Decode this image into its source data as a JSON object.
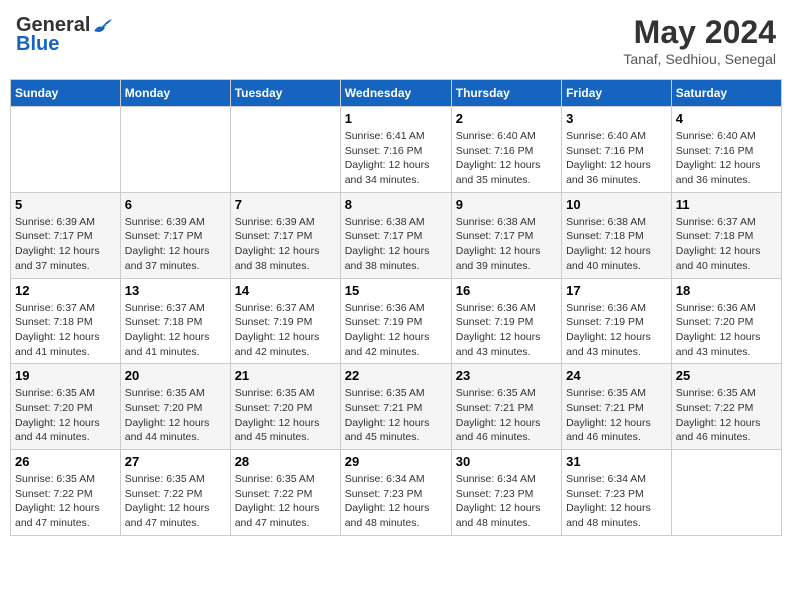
{
  "header": {
    "logo_general": "General",
    "logo_blue": "Blue",
    "title": "May 2024",
    "subtitle": "Tanaf, Sedhiou, Senegal"
  },
  "days_of_week": [
    "Sunday",
    "Monday",
    "Tuesday",
    "Wednesday",
    "Thursday",
    "Friday",
    "Saturday"
  ],
  "weeks": [
    {
      "days": [
        {
          "number": "",
          "info": ""
        },
        {
          "number": "",
          "info": ""
        },
        {
          "number": "",
          "info": ""
        },
        {
          "number": "1",
          "info": "Sunrise: 6:41 AM\nSunset: 7:16 PM\nDaylight: 12 hours\nand 34 minutes."
        },
        {
          "number": "2",
          "info": "Sunrise: 6:40 AM\nSunset: 7:16 PM\nDaylight: 12 hours\nand 35 minutes."
        },
        {
          "number": "3",
          "info": "Sunrise: 6:40 AM\nSunset: 7:16 PM\nDaylight: 12 hours\nand 36 minutes."
        },
        {
          "number": "4",
          "info": "Sunrise: 6:40 AM\nSunset: 7:16 PM\nDaylight: 12 hours\nand 36 minutes."
        }
      ]
    },
    {
      "days": [
        {
          "number": "5",
          "info": "Sunrise: 6:39 AM\nSunset: 7:17 PM\nDaylight: 12 hours\nand 37 minutes."
        },
        {
          "number": "6",
          "info": "Sunrise: 6:39 AM\nSunset: 7:17 PM\nDaylight: 12 hours\nand 37 minutes."
        },
        {
          "number": "7",
          "info": "Sunrise: 6:39 AM\nSunset: 7:17 PM\nDaylight: 12 hours\nand 38 minutes."
        },
        {
          "number": "8",
          "info": "Sunrise: 6:38 AM\nSunset: 7:17 PM\nDaylight: 12 hours\nand 38 minutes."
        },
        {
          "number": "9",
          "info": "Sunrise: 6:38 AM\nSunset: 7:17 PM\nDaylight: 12 hours\nand 39 minutes."
        },
        {
          "number": "10",
          "info": "Sunrise: 6:38 AM\nSunset: 7:18 PM\nDaylight: 12 hours\nand 40 minutes."
        },
        {
          "number": "11",
          "info": "Sunrise: 6:37 AM\nSunset: 7:18 PM\nDaylight: 12 hours\nand 40 minutes."
        }
      ]
    },
    {
      "days": [
        {
          "number": "12",
          "info": "Sunrise: 6:37 AM\nSunset: 7:18 PM\nDaylight: 12 hours\nand 41 minutes."
        },
        {
          "number": "13",
          "info": "Sunrise: 6:37 AM\nSunset: 7:18 PM\nDaylight: 12 hours\nand 41 minutes."
        },
        {
          "number": "14",
          "info": "Sunrise: 6:37 AM\nSunset: 7:19 PM\nDaylight: 12 hours\nand 42 minutes."
        },
        {
          "number": "15",
          "info": "Sunrise: 6:36 AM\nSunset: 7:19 PM\nDaylight: 12 hours\nand 42 minutes."
        },
        {
          "number": "16",
          "info": "Sunrise: 6:36 AM\nSunset: 7:19 PM\nDaylight: 12 hours\nand 43 minutes."
        },
        {
          "number": "17",
          "info": "Sunrise: 6:36 AM\nSunset: 7:19 PM\nDaylight: 12 hours\nand 43 minutes."
        },
        {
          "number": "18",
          "info": "Sunrise: 6:36 AM\nSunset: 7:20 PM\nDaylight: 12 hours\nand 43 minutes."
        }
      ]
    },
    {
      "days": [
        {
          "number": "19",
          "info": "Sunrise: 6:35 AM\nSunset: 7:20 PM\nDaylight: 12 hours\nand 44 minutes."
        },
        {
          "number": "20",
          "info": "Sunrise: 6:35 AM\nSunset: 7:20 PM\nDaylight: 12 hours\nand 44 minutes."
        },
        {
          "number": "21",
          "info": "Sunrise: 6:35 AM\nSunset: 7:20 PM\nDaylight: 12 hours\nand 45 minutes."
        },
        {
          "number": "22",
          "info": "Sunrise: 6:35 AM\nSunset: 7:21 PM\nDaylight: 12 hours\nand 45 minutes."
        },
        {
          "number": "23",
          "info": "Sunrise: 6:35 AM\nSunset: 7:21 PM\nDaylight: 12 hours\nand 46 minutes."
        },
        {
          "number": "24",
          "info": "Sunrise: 6:35 AM\nSunset: 7:21 PM\nDaylight: 12 hours\nand 46 minutes."
        },
        {
          "number": "25",
          "info": "Sunrise: 6:35 AM\nSunset: 7:22 PM\nDaylight: 12 hours\nand 46 minutes."
        }
      ]
    },
    {
      "days": [
        {
          "number": "26",
          "info": "Sunrise: 6:35 AM\nSunset: 7:22 PM\nDaylight: 12 hours\nand 47 minutes."
        },
        {
          "number": "27",
          "info": "Sunrise: 6:35 AM\nSunset: 7:22 PM\nDaylight: 12 hours\nand 47 minutes."
        },
        {
          "number": "28",
          "info": "Sunrise: 6:35 AM\nSunset: 7:22 PM\nDaylight: 12 hours\nand 47 minutes."
        },
        {
          "number": "29",
          "info": "Sunrise: 6:34 AM\nSunset: 7:23 PM\nDaylight: 12 hours\nand 48 minutes."
        },
        {
          "number": "30",
          "info": "Sunrise: 6:34 AM\nSunset: 7:23 PM\nDaylight: 12 hours\nand 48 minutes."
        },
        {
          "number": "31",
          "info": "Sunrise: 6:34 AM\nSunset: 7:23 PM\nDaylight: 12 hours\nand 48 minutes."
        },
        {
          "number": "",
          "info": ""
        }
      ]
    }
  ]
}
